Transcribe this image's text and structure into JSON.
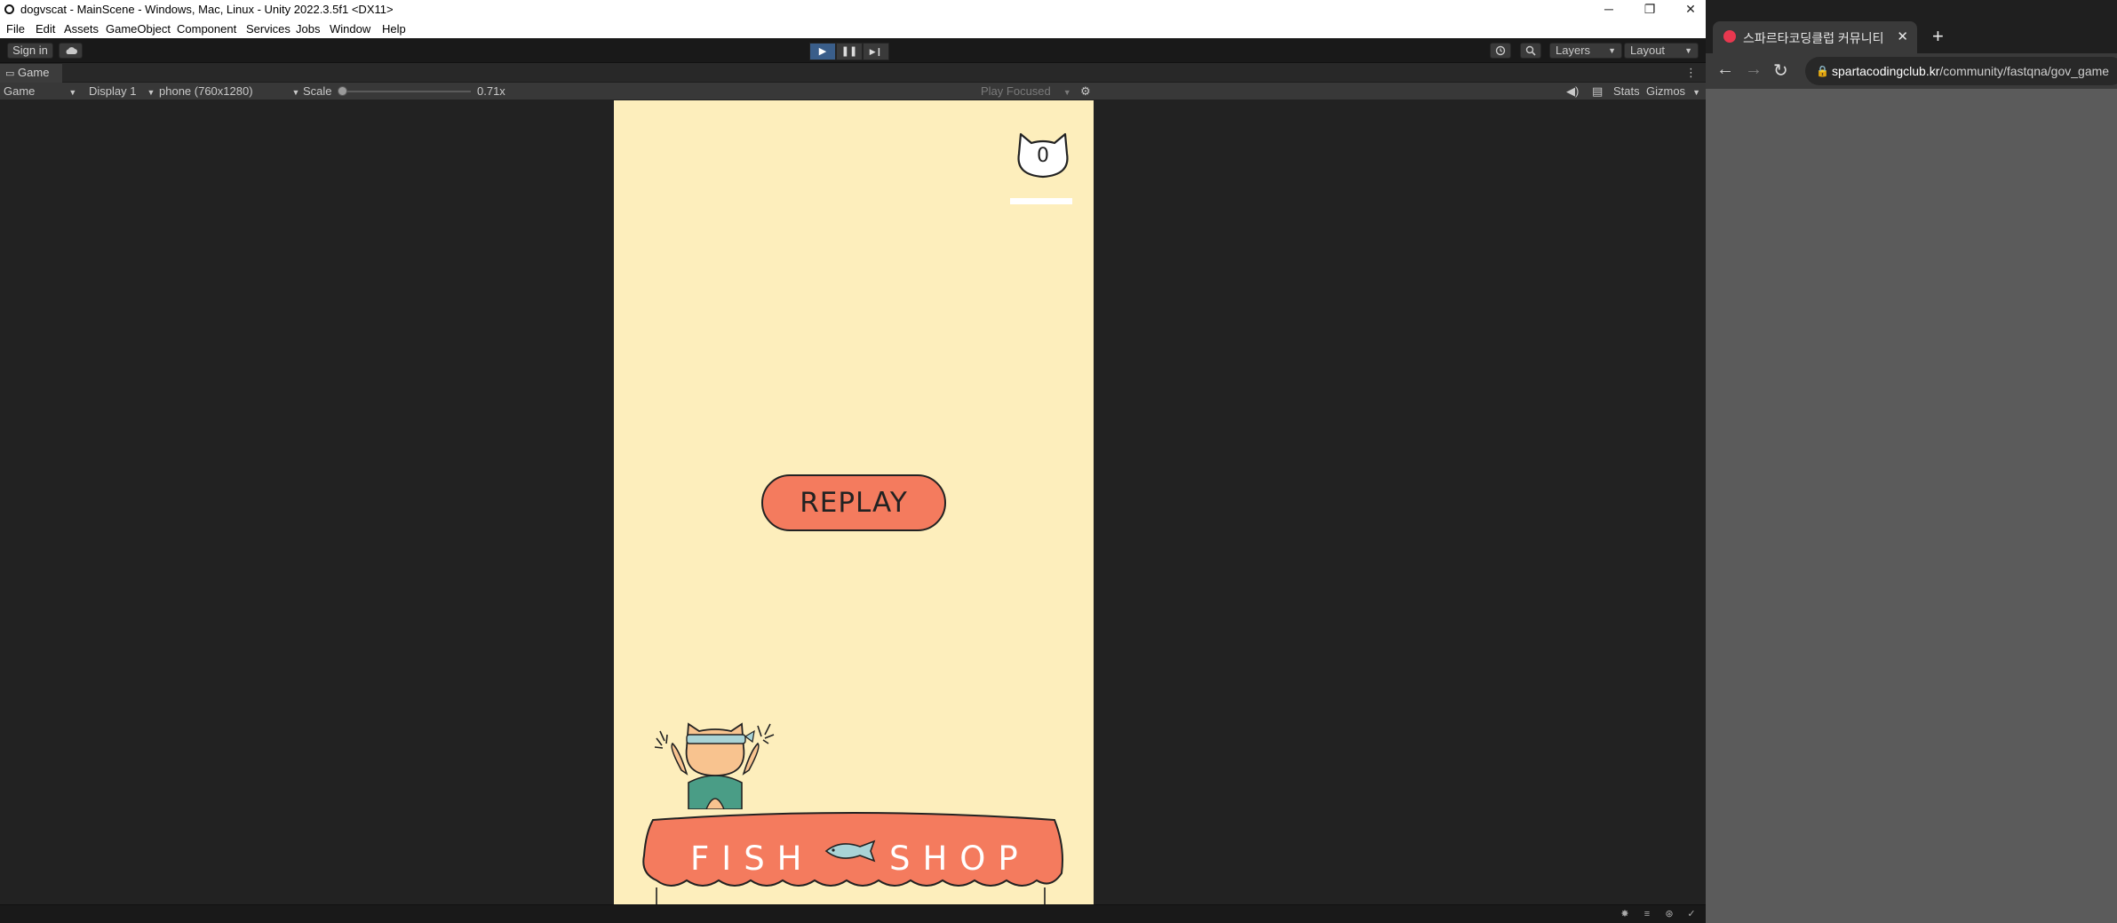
{
  "window": {
    "title": "dogvscat - MainScene - Windows, Mac, Linux - Unity 2022.3.5f1 <DX11>",
    "minimize": "─",
    "restore": "❐",
    "close": "✕"
  },
  "menu": [
    "File",
    "Edit",
    "Assets",
    "GameObject",
    "Component",
    "Services",
    "Jobs",
    "Window",
    "Help"
  ],
  "toolbar": {
    "sign_in": "Sign in",
    "cloud_icon": "cloud-icon",
    "play_icon": "▶",
    "pause_icon": "❚❚",
    "step_icon": "▶❙",
    "history_icon": "history-icon",
    "search_icon": "search-icon",
    "layers": "Layers",
    "layout": "Layout"
  },
  "game_tab": {
    "label": "Game"
  },
  "game_toolbar": {
    "mode": "Game",
    "display": "Display 1",
    "resolution": "phone (760x1280)",
    "scale_label": "Scale",
    "scale_value": "0.71x",
    "scale_fraction": 0.0,
    "play_focused": "Play Focused",
    "stats": "Stats",
    "gizmos": "Gizmos"
  },
  "game": {
    "score": "0",
    "replay_label": "REPLAY",
    "shop_left": "FISH",
    "shop_right": "SHOP"
  },
  "browser": {
    "tab_title": "스파르타코딩클럽 커뮤니티 | 스",
    "tab_close": "✕",
    "new_tab": "+",
    "url_host": "spartacodingclub.kr",
    "url_path": "/community/fastqna/gov_game"
  },
  "colors": {
    "canvas_bg": "#fdeebc",
    "replay_button": "#f47b5e",
    "awning": "#f47b5e",
    "play_active": "#3a5e8a"
  }
}
